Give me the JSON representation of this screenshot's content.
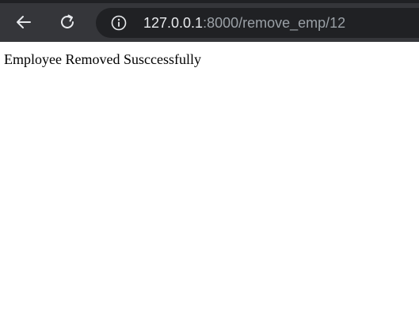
{
  "toolbar": {
    "back_icon": "arrow-left-icon",
    "reload_icon": "reload-icon",
    "info_icon": "info-icon",
    "url_host": "127.0.0.1",
    "url_path": ":8000/remove_emp/12"
  },
  "page": {
    "message": "Employee Removed Susccessfully"
  },
  "colors": {
    "toolbar_bg": "#35363a",
    "omnibox_bg": "#202124",
    "url_host_text": "#e8eaed",
    "url_path_text": "#9aa0a6",
    "page_bg": "#ffffff"
  }
}
